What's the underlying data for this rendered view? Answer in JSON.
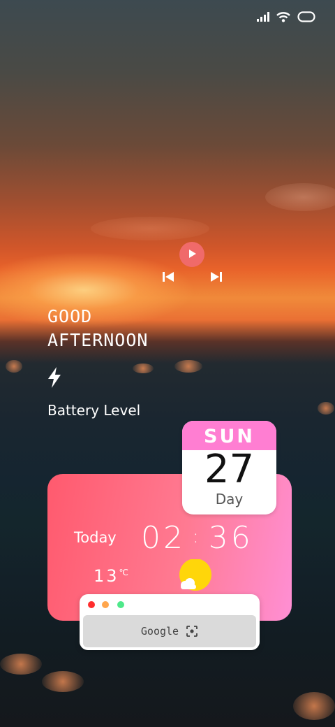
{
  "status_bar": {
    "signal_icon": "signal-bars-icon",
    "wifi_icon": "wifi-icon",
    "battery_icon": "battery-outline-icon"
  },
  "music": {
    "play_icon": "play-icon",
    "prev_icon": "skip-previous-icon",
    "next_icon": "skip-next-icon",
    "play_color": "#f06a6a"
  },
  "greeting": {
    "line1": "GOOD",
    "line2": "AFTERNOON"
  },
  "battery": {
    "icon": "lightning-bolt-icon",
    "label": "Battery Level"
  },
  "date_card": {
    "weekday": "SUN",
    "day": "27",
    "caption": "Day",
    "header_color": "#ff7ed2"
  },
  "clock_widget": {
    "today_label": "Today",
    "hours": "02",
    "separator": ":",
    "minutes": "36",
    "temperature": "13",
    "temperature_unit": "℃",
    "weather_icon": "sun-behind-cloud-icon",
    "gradient_start": "#ff5a6e",
    "gradient_end": "#ff8fd4"
  },
  "browser_widget": {
    "search_label": "Google",
    "lens_icon": "google-lens-icon",
    "window_dots": [
      "#ff2d2d",
      "#ffa64d",
      "#4ee88a"
    ]
  }
}
